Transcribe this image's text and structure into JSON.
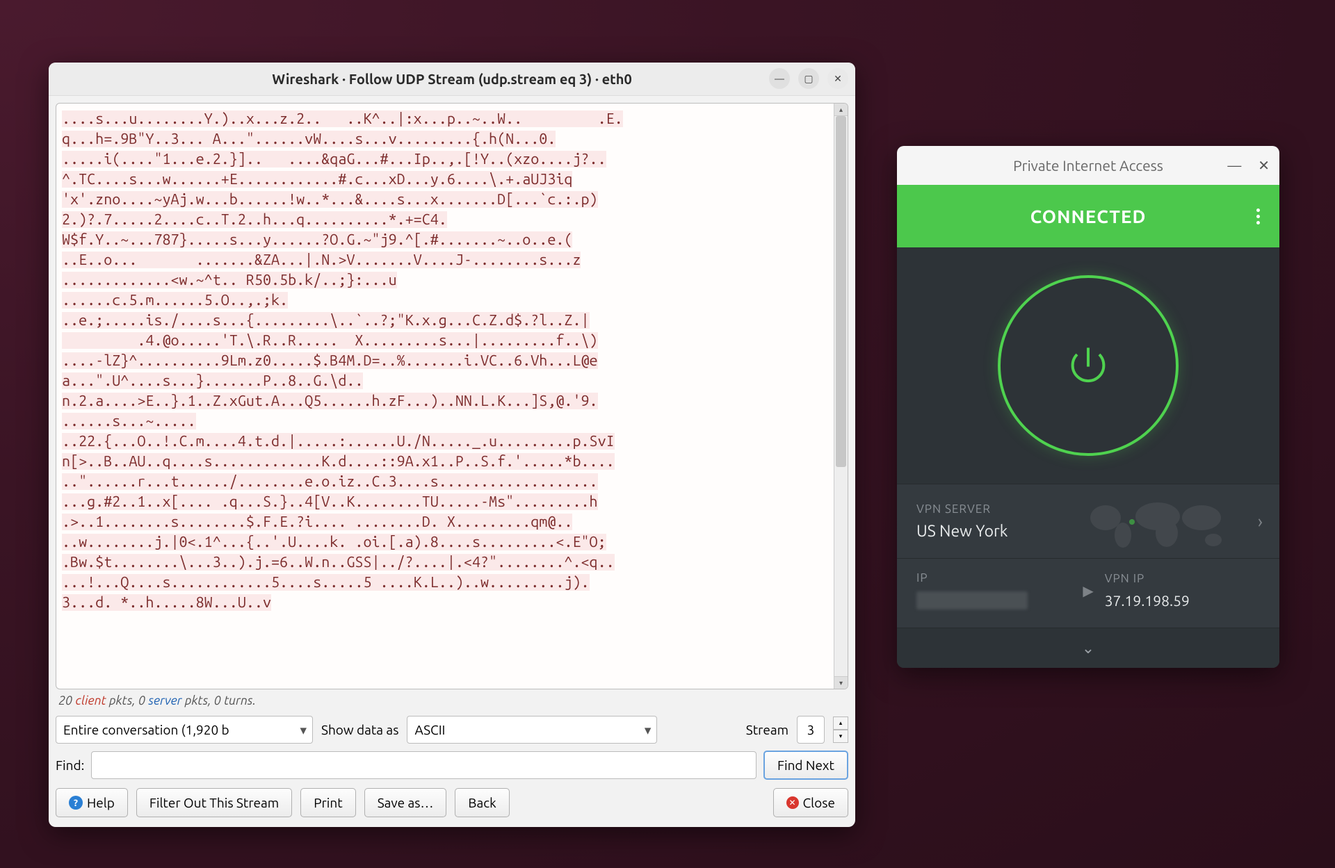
{
  "wireshark": {
    "title": "Wireshark · Follow UDP Stream (udp.stream eq 3) · eth0",
    "stream_text": "....s...u........Y.)..x...z.2..   ..K^..|:x...p..~..W..         .E.\nq...h=.9B\"Y..3... A...\"......vW....s...v.........{.h(N...0.\n.....i(....\"1...e.2.}]..   ....&qaG...#...Ip..,.[!Y..(xzo....j?..\n^.TC....s...w......+E............#.c...xD...y.6....\\.+.aUJ3iq\n'x'.zno....~yAj.w...b......!w..*...&....s...x.......D[...`c.:.p)\n2.)?.7.....2....c..T.2..h...q..........*.+=C4.\nW$f.Y..~...787}.....s...y......?O.G.~\"j9.^[.#.......~..o..e.(\n..E..o...       .......&ZA...|.N.>V.......V....J-........s...z\n.............<w.~^t.. R50.5b.k/..;}:...u\n......c.5.m......5.O..,.;k.\n..e.;.....is./....s...{.........\\..`..?;\"K.x.g...C.Z.d$.?l..Z.|\n         .4.@o.....'T.\\.R..R.....  X.........s...|.........f..\\)\n....-lZ}^..........9Lm.z0.....$.B4M.D=..%.......i.VC..6.Vh...L@e\na...\".U^....s...}.......P..8..G.\\d..\nn.2.a....>E..}.1..Z.xGut.A...Q5......h.zF...)..NN.L.K...]S,@.'9.\n......s...~.....\n..22.{...O..!.C.m....4.t.d.|.....:......U./N....._.u.........p.SvI\nn[>..B..AU..q....s.............K.d....::9A.x1..P..S.f.'.....*b....\n..\"......r...t....../........e.o.iz..C.3....s...................\n...g.#2..1..x[.... .q...S.}..4[V..K........TU.....-Ms\".........h\n.>..1........s........$.F.E.?i.... ........D. X.........qm@..\n..w........j.|0<.1^...{..'.U....k. .oi.[.a).8....s.........<.E\"O;\n.Bw.$t........\\...3..).j.=6..W.n..GSS|../?....|.<4?\"........^.<q..\n...!...Q....s............5....s.....5 ....K.L..)..w.........j).\n3...d. *..h.....8W...U..v",
    "status": {
      "pre": "20 ",
      "client": "client",
      "mid": " pkts, 0 ",
      "server": "server",
      "post": " pkts, 0 turns."
    },
    "conversation_select": "Entire conversation (1,920 b",
    "show_data_label": "Show data as",
    "encoding_select": "ASCII",
    "stream_label": "Stream",
    "stream_value": "3",
    "find_label": "Find:",
    "find_input": "",
    "find_next": "Find Next",
    "buttons": {
      "help": "Help",
      "filter": "Filter Out This Stream",
      "print": "Print",
      "save": "Save as…",
      "back": "Back",
      "close": "Close"
    }
  },
  "pia": {
    "title": "Private Internet Access",
    "status": "CONNECTED",
    "server_label": "VPN SERVER",
    "server_value": "US New York",
    "ip_label": "IP",
    "vpnip_label": "VPN IP",
    "vpnip_value": "37.19.198.59"
  }
}
